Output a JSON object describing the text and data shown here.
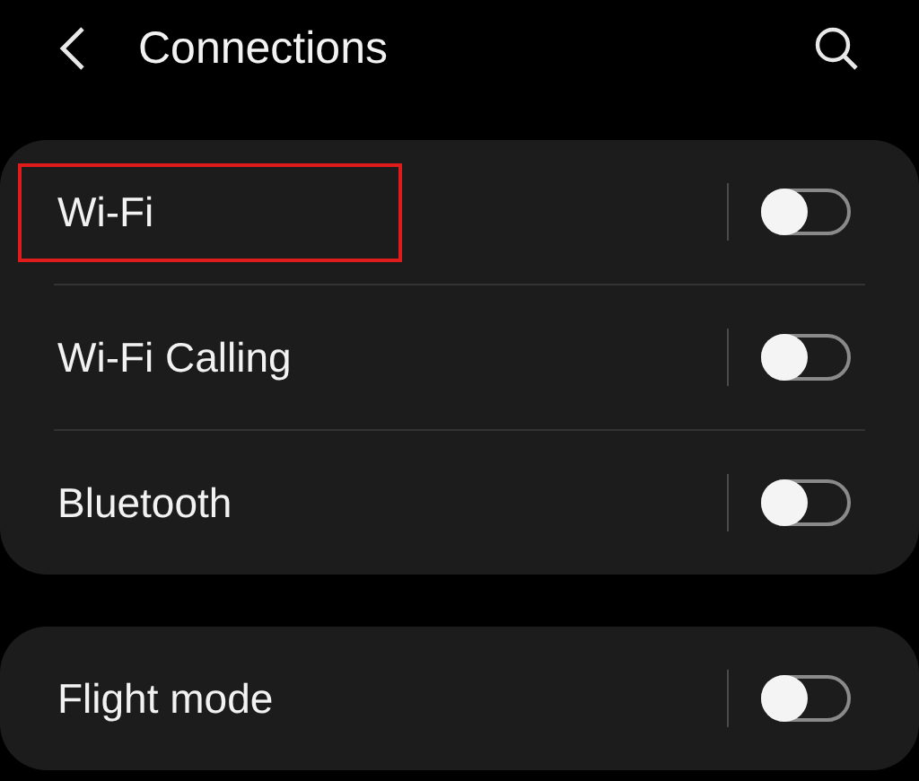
{
  "header": {
    "title": "Connections"
  },
  "groups": [
    {
      "items": [
        {
          "label": "Wi-Fi",
          "on": false,
          "highlighted": true
        },
        {
          "label": "Wi-Fi Calling",
          "on": false,
          "highlighted": false
        },
        {
          "label": "Bluetooth",
          "on": false,
          "highlighted": false
        }
      ]
    },
    {
      "items": [
        {
          "label": "Flight mode",
          "on": false,
          "highlighted": false
        }
      ]
    }
  ]
}
